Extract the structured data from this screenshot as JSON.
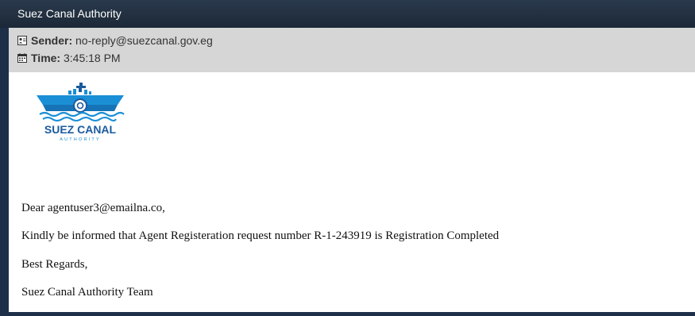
{
  "window": {
    "title": "Suez Canal Authority"
  },
  "email": {
    "sender_label": "Sender:",
    "sender_value": "no-reply@suezcanal.gov.eg",
    "time_label": "Time:",
    "time_value": "3:45:18 PM",
    "logo_text": "SUEZ CANAL",
    "logo_subtext": "AUTHORITY",
    "greeting": "Dear agentuser3@emailna.co,",
    "message": "Kindly be informed that Agent Registeration request number R-1-243919 is Registration Completed",
    "closing": "Best Regards,",
    "signature": "Suez Canal Authority Team"
  },
  "colors": {
    "titlebar": "#1f2d3d",
    "frame": "#1e2f4a",
    "meta_background": "#d6d6d6",
    "logo_blue": "#1a8fd6"
  },
  "icons": {
    "sender": "contact-card-icon",
    "time": "calendar-icon"
  }
}
